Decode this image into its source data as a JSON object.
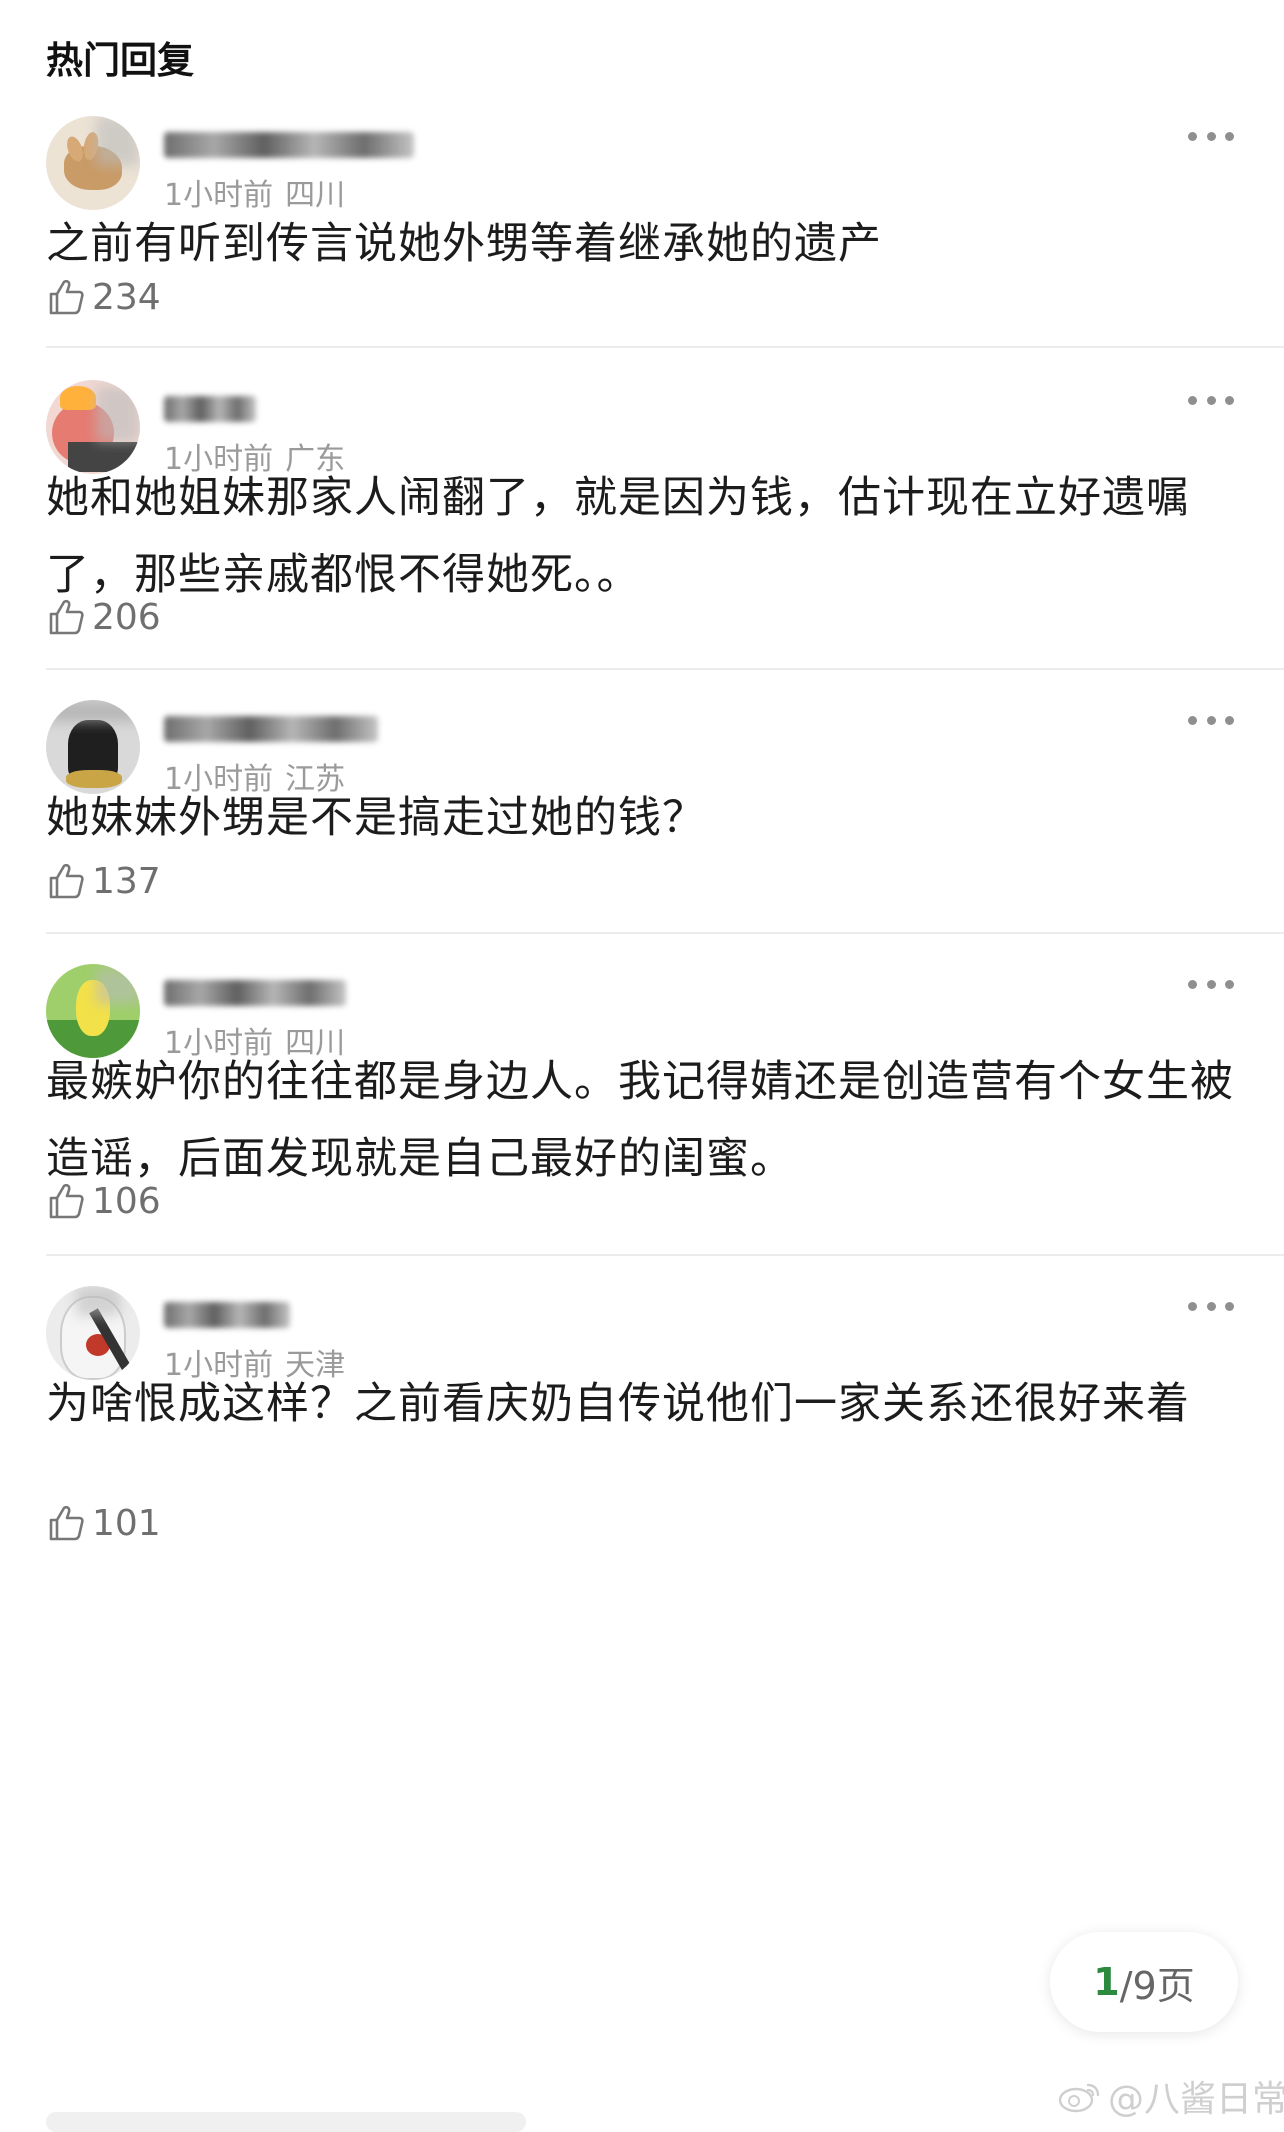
{
  "section_title": "热门回复",
  "comments": [
    {
      "time": "1小时前",
      "location": "四川",
      "text": "之前有听到传言说她外甥等着继承她的遗产",
      "likes": "234",
      "avatar_color": "#c8a77a"
    },
    {
      "time": "1小时前",
      "location": "广东",
      "text": "她和她姐妹那家人闹翻了，就是因为钱，估计现在立好遗嘱了，那些亲戚都恨不得她死。。",
      "likes": "206",
      "avatar_color": "#e67b72"
    },
    {
      "time": "1小时前",
      "location": "江苏",
      "text": "她妹妹外甥是不是搞走过她的钱？",
      "likes": "137",
      "avatar_color": "#3a3a3a"
    },
    {
      "time": "1小时前",
      "location": "四川",
      "text": "最嫉妒你的往往都是身边人。我记得婧还是创造营有个女生被造谣，后面发现就是自己最好的闺蜜。",
      "likes": "106",
      "avatar_color": "#8bbf5a"
    },
    {
      "time": "1小时前",
      "location": "天津",
      "text": "为啥恨成这样？之前看庆奶自传说他们一家关系还很好来着",
      "likes": "101",
      "avatar_color": "#d8d8d8"
    }
  ],
  "pager": {
    "current": "1",
    "total": "/9页"
  },
  "watermark": "@八酱日常",
  "colors": {
    "accent_green": "#2b8a3e",
    "meta_gray": "#9a9a9a",
    "divider": "#ececec"
  },
  "icons": {
    "like": "thumbs-up-icon",
    "more": "ellipsis-icon",
    "watermark": "weibo-logo-icon"
  }
}
